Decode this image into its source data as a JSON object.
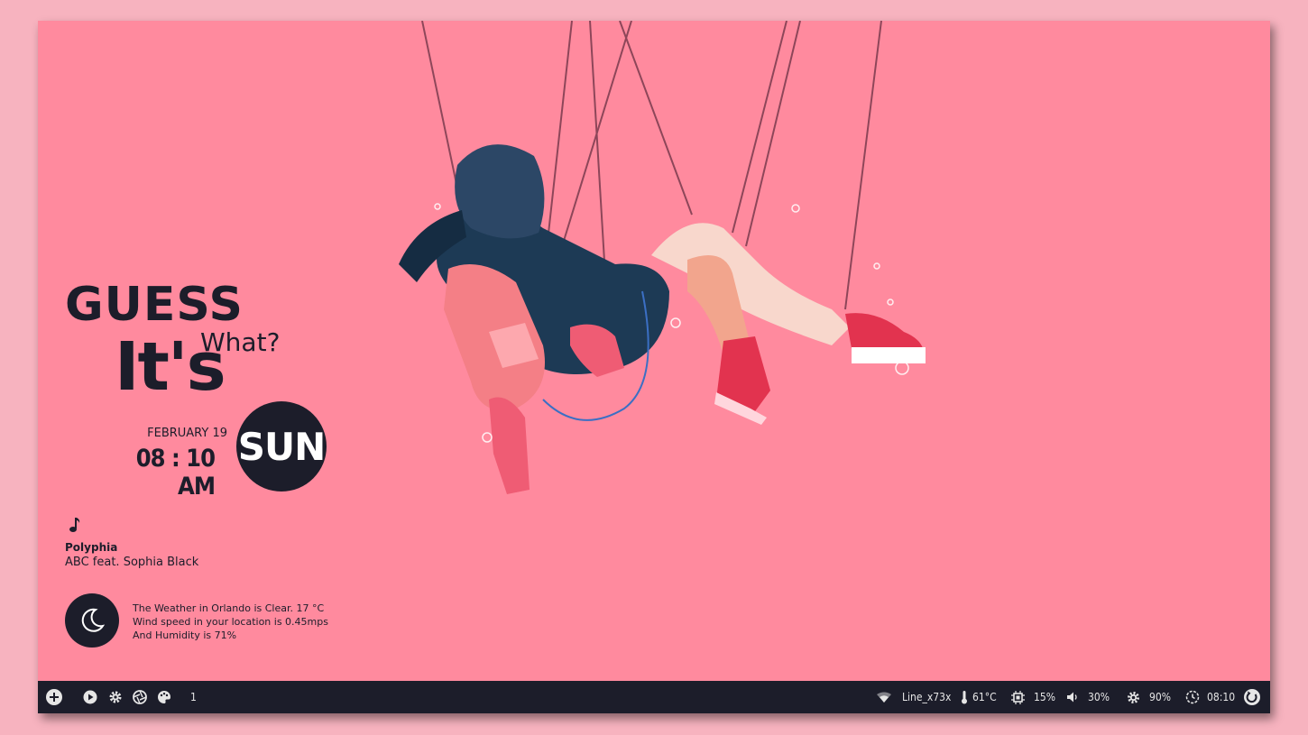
{
  "desktop": {
    "headline": "GUESS",
    "its": "It's",
    "what": "What?",
    "date": "FEBRUARY 19",
    "time": "08 : 10 AM",
    "day": "SUN"
  },
  "music": {
    "icon": "music-note-icon",
    "artist": "Polyphia",
    "track": "ABC feat. Sophia Black"
  },
  "weather": {
    "icon": "moon-icon",
    "line1": "The Weather in Orlando is Clear. 17 °C",
    "line2": "Wind speed in your location is 0.45mps",
    "line3": "And Humidity is 71%"
  },
  "panel": {
    "left": {
      "launcher_icon": "plus-circle-icon",
      "play_icon": "play-circle-icon",
      "settings_icon": "gear-icon",
      "screenshot_icon": "aperture-icon",
      "theme_icon": "palette-icon",
      "workspace": "1"
    },
    "right": {
      "wifi_icon": "wifi-icon",
      "network": "Line_x73x",
      "temp_icon": "thermometer-icon",
      "temperature": "61°C",
      "cpu_icon": "cpu-icon",
      "cpu": "15%",
      "volume_icon": "speaker-icon",
      "volume": "30%",
      "brightness_icon": "brightness-icon",
      "brightness": "90%",
      "clock_icon": "clock-icon",
      "clock": "08:10",
      "power_icon": "power-icon"
    }
  },
  "colors": {
    "background": "#ff8a9e",
    "dark": "#1c1d2a",
    "text_light": "#e6e6e6"
  }
}
